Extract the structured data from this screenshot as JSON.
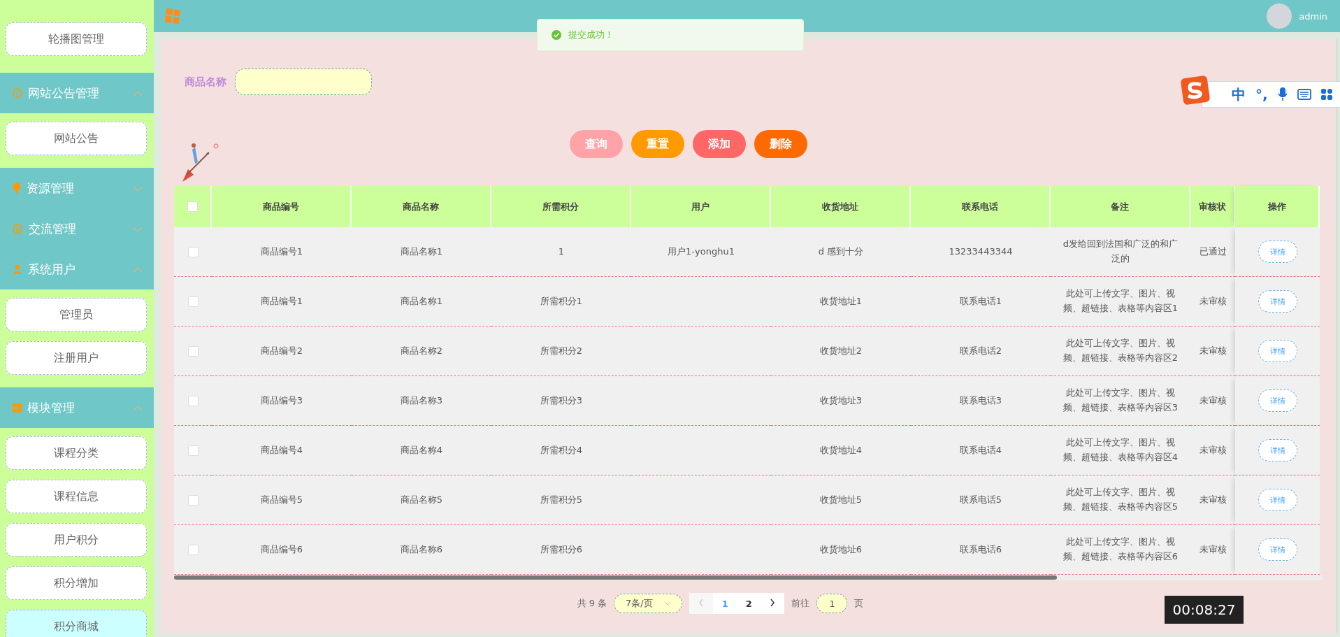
{
  "sidebar": {
    "groups": [
      {
        "children": [
          {
            "label": "轮播图管理",
            "highlighted": false
          }
        ]
      },
      {
        "label": "网站公告管理",
        "expanded": true,
        "children": [
          {
            "label": "网站公告",
            "highlighted": false
          }
        ]
      },
      {
        "label": "资源管理",
        "expanded": false
      },
      {
        "label": "交流管理",
        "expanded": false
      },
      {
        "label": "系统用户",
        "expanded": true,
        "children": [
          {
            "label": "管理员",
            "highlighted": false
          },
          {
            "label": "注册用户",
            "highlighted": false
          }
        ]
      },
      {
        "label": "模块管理",
        "expanded": true,
        "children": [
          {
            "label": "课程分类",
            "highlighted": false
          },
          {
            "label": "课程信息",
            "highlighted": false
          },
          {
            "label": "用户积分",
            "highlighted": false
          },
          {
            "label": "积分增加",
            "highlighted": false
          },
          {
            "label": "积分商城",
            "highlighted": true
          }
        ]
      }
    ]
  },
  "header": {
    "user": "admin"
  },
  "toast": {
    "message": "提交成功！"
  },
  "search": {
    "label": "商品名称"
  },
  "actions": [
    {
      "label": "查询",
      "color": "#ffa3a9"
    },
    {
      "label": "重置",
      "color": "#ff9a00"
    },
    {
      "label": "添加",
      "color": "#ff6666"
    },
    {
      "label": "删除",
      "color": "#ff6a00"
    }
  ],
  "table": {
    "header_checked": false,
    "columns": [
      "商品编号",
      "商品名称",
      "所需积分",
      "用户",
      "收货地址",
      "联系电话",
      "备注",
      "审核状",
      "操作"
    ],
    "rows": [
      {
        "checked": false,
        "cells": [
          "商品编号1",
          "商品名称1",
          "1",
          "用户1-yonghu1",
          "d 感到十分",
          "13233443344",
          "d发给回到法国和广泛的和广泛的",
          "已通过"
        ],
        "action": "详情"
      },
      {
        "checked": false,
        "cells": [
          "商品编号1",
          "商品名称1",
          "所需积分1",
          null,
          "收货地址1",
          "联系电话1",
          "此处可上传文字、图片、视频、超链接、表格等内容区1",
          "未审核"
        ],
        "action": "详情"
      },
      {
        "checked": false,
        "cells": [
          "商品编号2",
          "商品名称2",
          "所需积分2",
          null,
          "收货地址2",
          "联系电话2",
          "此处可上传文字、图片、视频、超链接、表格等内容区2",
          "未审核"
        ],
        "action": "详情"
      },
      {
        "checked": false,
        "cells": [
          "商品编号3",
          "商品名称3",
          "所需积分3",
          null,
          "收货地址3",
          "联系电话3",
          "此处可上传文字、图片、视频、超链接、表格等内容区3",
          "未审核"
        ],
        "action": "详情"
      },
      {
        "checked": false,
        "cells": [
          "商品编号4",
          "商品名称4",
          "所需积分4",
          null,
          "收货地址4",
          "联系电话4",
          "此处可上传文字、图片、视频、超链接、表格等内容区4",
          "未审核"
        ],
        "action": "详情"
      },
      {
        "checked": false,
        "cells": [
          "商品编号5",
          "商品名称5",
          "所需积分5",
          null,
          "收货地址5",
          "联系电话5",
          "此处可上传文字、图片、视频、超链接、表格等内容区5",
          "未审核"
        ],
        "action": "详情"
      },
      {
        "checked": false,
        "cells": [
          "商品编号6",
          "商品名称6",
          "所需积分6",
          null,
          "收货地址6",
          "联系电话6",
          "此处可上传文字、图片、视频、超链接、表格等内容区6",
          "未审核"
        ],
        "action": "详情"
      }
    ]
  },
  "pagination": {
    "total": "共 9 条",
    "page_size": "7条/页",
    "pages": [
      {
        "label": "1",
        "selected": true
      },
      {
        "label": "2",
        "selected": false
      }
    ],
    "goto_label": "前往",
    "goto_value": "1",
    "goto_suffix": "页"
  },
  "ime_toolbar": {
    "mode": "中",
    "punctuation": "°,"
  },
  "video_time": "00:08:27"
}
